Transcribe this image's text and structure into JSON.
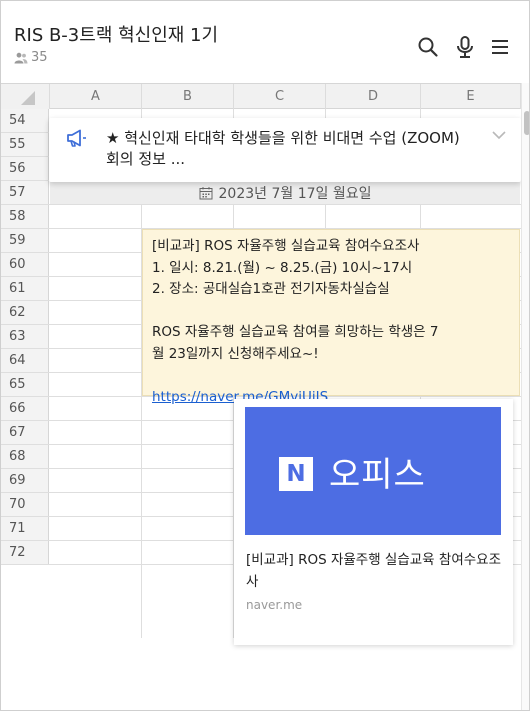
{
  "header": {
    "title": "RIS B-3트랙 혁신인재 1기",
    "member_count": "35",
    "icons": [
      "search-icon",
      "microphone-icon",
      "menu-icon"
    ]
  },
  "sheet": {
    "columns": [
      "A",
      "B",
      "C",
      "D",
      "E"
    ],
    "rows": [
      "54",
      "55",
      "56",
      "57",
      "58",
      "59",
      "60",
      "61",
      "62",
      "63",
      "64",
      "65",
      "66",
      "67",
      "68",
      "69",
      "70",
      "71",
      "72"
    ]
  },
  "notice": {
    "icon": "megaphone-icon",
    "text": "★ 혁신인재 타대학 학생들을 위한 비대면 수업 (ZOOM) 회의 정보 ..."
  },
  "date_banner": {
    "icon": "calendar-icon",
    "text": "2023년 7월 17일 월요일"
  },
  "message": {
    "lines": [
      "[비교과] ROS 자율주행 실습교육 참여수요조사",
      "1. 일시: 8.21.(월) ~ 8.25.(금) 10시~17시",
      "2. 장소: 공대실습1호관 전기자동차실습실",
      "",
      "ROS 자율주행 실습교육 참여를 희망하는 학생은 7",
      "월 23일까지 신청해주세요~!",
      ""
    ],
    "link": "https://naver.me/GMviUjIS"
  },
  "link_card": {
    "logo_letter": "N",
    "brand": "오피스",
    "title": "[비교과] ROS 자율주행 실습교육 참여수요조사",
    "domain": "naver.me"
  },
  "colors": {
    "message_bg": "#fdf5dc",
    "link": "#1a5fd0",
    "card_banner": "#4d6de3"
  }
}
